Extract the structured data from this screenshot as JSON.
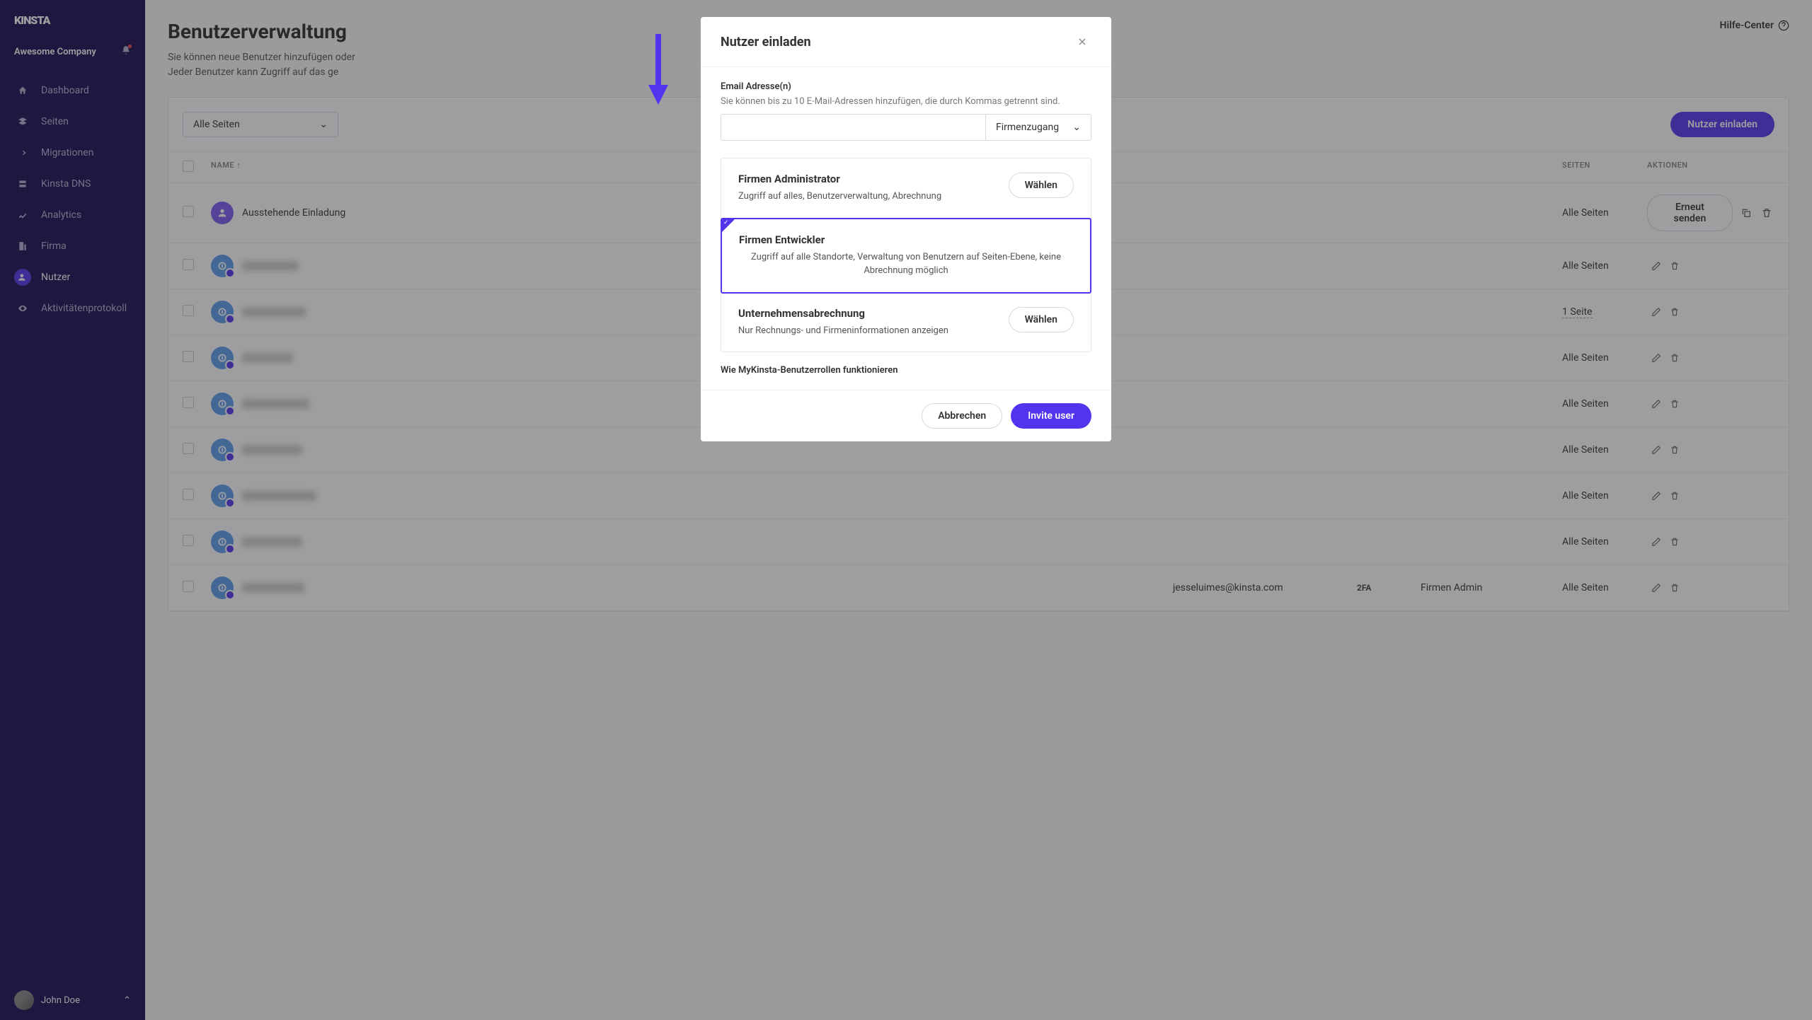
{
  "brand": "kinsta",
  "company_name": "Awesome Company",
  "nav": {
    "dashboard": "Dashboard",
    "sites": "Seiten",
    "migrations": "Migrationen",
    "dns": "Kinsta DNS",
    "analytics": "Analytics",
    "company": "Firma",
    "users": "Nutzer",
    "activity": "Aktivitätenprotokoll"
  },
  "profile_name": "John Doe",
  "header": {
    "title": "Benutzerverwaltung",
    "help": "Hilfe-Center",
    "subtitle_l1": "Sie können neue Benutzer hinzufügen oder",
    "subtitle_l2": "Jeder Benutzer kann Zugriff auf das ge"
  },
  "filter": {
    "all_sites": "Alle Seiten"
  },
  "invite_btn": "Nutzer einladen",
  "columns": {
    "name": "NAME",
    "sites": "SEITEN",
    "actions": "AKTIONEN"
  },
  "rows": {
    "pending_label": "Ausstehende Einladung",
    "resend": "Erneut senden",
    "all_sites": "Alle Seiten",
    "one_site": "1 Seite",
    "email": "jesseluimes@kinsta.com",
    "twofa": "2FA",
    "role_admin": "Firmen Admin"
  },
  "modal": {
    "title": "Nutzer einladen",
    "email_label": "Email Adresse(n)",
    "email_hint": "Sie können bis zu 10 E-Mail-Adressen hinzufügen, die durch Kommas getrennt sind.",
    "access_type": "Firmenzugang",
    "roles": {
      "admin": {
        "title": "Firmen Administrator",
        "desc": "Zugriff auf alles, Benutzerverwaltung, Abrechnung",
        "choose": "Wählen"
      },
      "dev": {
        "title": "Firmen Entwickler",
        "desc": "Zugriff auf alle Standorte, Verwaltung von Benutzern auf Seiten-Ebene, keine Abrechnung möglich"
      },
      "billing": {
        "title": "Unternehmensabrechnung",
        "desc": "Nur Rechnungs- und Firmeninformationen anzeigen",
        "choose": "Wählen"
      }
    },
    "roles_link": "Wie MyKinsta-Benutzerrollen funktionieren",
    "cancel": "Abbrechen",
    "submit": "Invite user"
  }
}
